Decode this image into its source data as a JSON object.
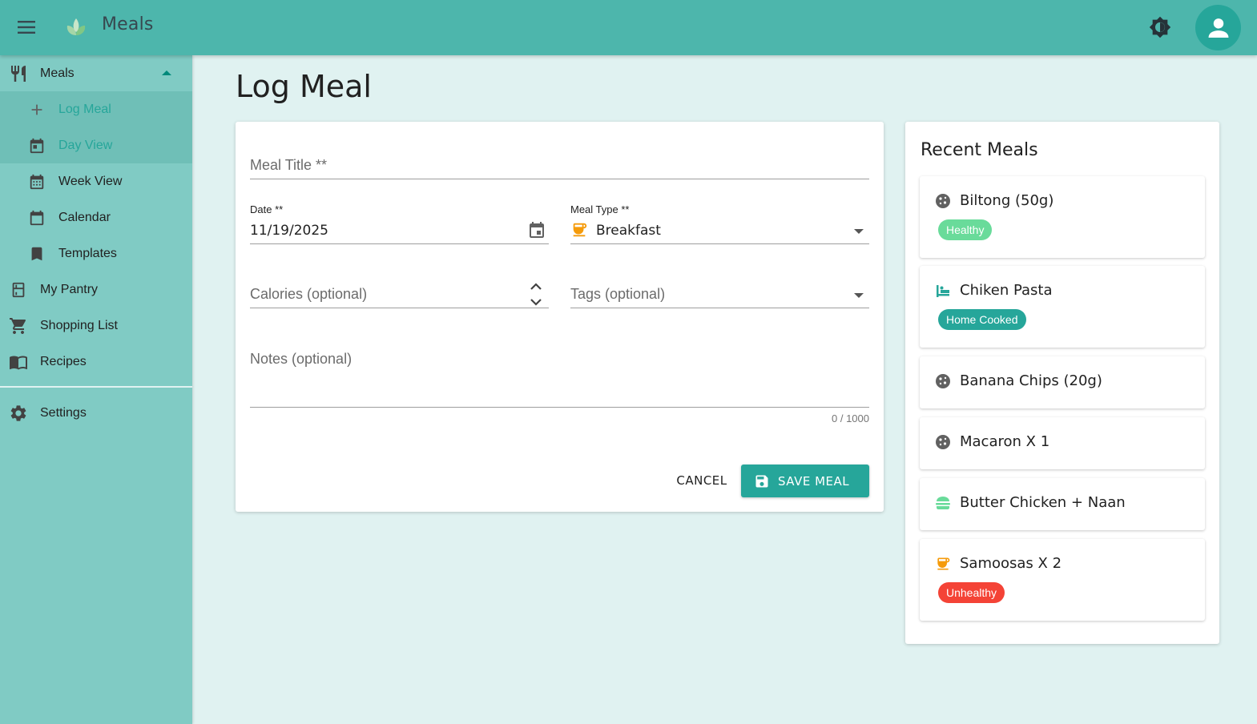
{
  "app": {
    "title": "Meals"
  },
  "sidebar": {
    "items": [
      {
        "label": "Meals"
      },
      {
        "label": "Log Meal"
      },
      {
        "label": "Day View"
      },
      {
        "label": "Week View"
      },
      {
        "label": "Calendar"
      },
      {
        "label": "Templates"
      },
      {
        "label": "My Pantry"
      },
      {
        "label": "Shopping List"
      },
      {
        "label": "Recipes"
      },
      {
        "label": "Settings"
      }
    ]
  },
  "page": {
    "title": "Log Meal"
  },
  "form": {
    "meal_title_placeholder": "Meal Title **",
    "date_label": "Date **",
    "date_value": "11/19/2025",
    "meal_type_label": "Meal Type **",
    "meal_type_value": "Breakfast",
    "calories_placeholder": "Calories (optional)",
    "tags_placeholder": "Tags (optional)",
    "notes_placeholder": "Notes (optional)",
    "notes_counter": "0 / 1000",
    "cancel_label": "CANCEL",
    "save_label": "SAVE MEAL"
  },
  "recent": {
    "title": "Recent Meals",
    "meals": [
      {
        "name": "Biltong (50g)",
        "icon": "cookie-icon",
        "tag": "Healthy",
        "tag_color": "#69db9a"
      },
      {
        "name": "Chiken Pasta",
        "icon": "dinner-icon",
        "tag": "Home Cooked",
        "tag_color": "#26a69a"
      },
      {
        "name": "Banana Chips (20g)",
        "icon": "cookie-icon"
      },
      {
        "name": "Macaron X 1",
        "icon": "cookie-icon"
      },
      {
        "name": "Butter Chicken + Naan",
        "icon": "lunch-icon"
      },
      {
        "name": "Samoosas X 2",
        "icon": "breakfast-icon",
        "tag": "Unhealthy",
        "tag_color": "#f44336"
      }
    ]
  },
  "colors": {
    "topbar": "#4db6ac",
    "sidebar": "#80cbc4",
    "accent": "#26a69a",
    "background": "#e0f2f1",
    "breakfast_icon": "#f59b0b",
    "cookie_icon": "#616161",
    "dinner_icon": "#26a69a",
    "lunch_icon": "#69db9a"
  }
}
